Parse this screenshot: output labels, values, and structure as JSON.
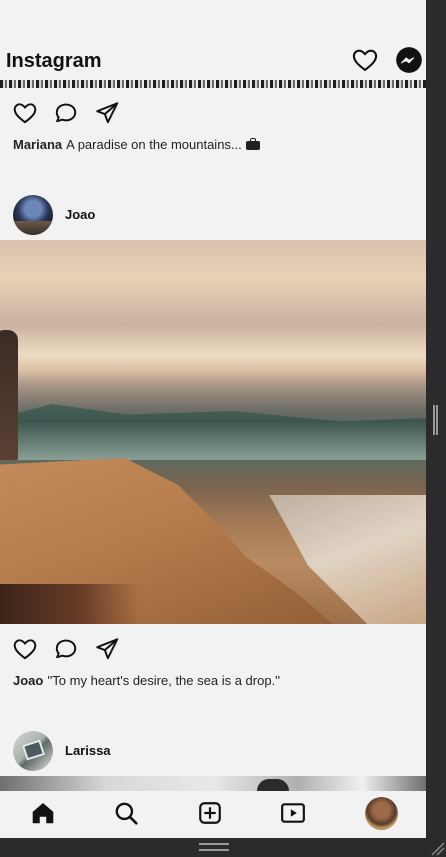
{
  "app": {
    "title": "Instagram"
  },
  "header": {
    "icons": [
      "heart-icon",
      "messenger-icon"
    ]
  },
  "posts": [
    {
      "username": "Mariana",
      "caption": "A paradise on the mountains...",
      "caption_emoji": "briefcase-icon"
    },
    {
      "username": "Joao",
      "caption": "''To my heart's desire, the sea is a drop.''"
    },
    {
      "username": "Larissa"
    }
  ],
  "post_actions": [
    "heart-icon",
    "comment-icon",
    "share-icon"
  ],
  "bottom_nav": {
    "items": [
      "home-icon",
      "search-icon",
      "add-post-icon",
      "reels-icon",
      "profile-avatar"
    ]
  },
  "colors": {
    "background": "#f2f2f2",
    "text": "#111111",
    "window_frame": "#2b2b2d"
  }
}
